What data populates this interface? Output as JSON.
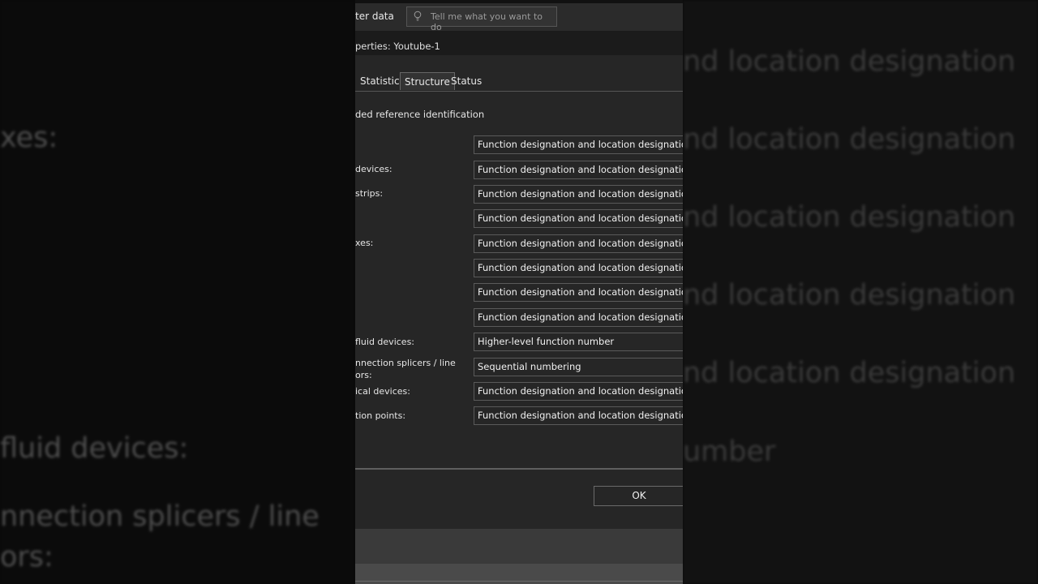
{
  "ribbon": {
    "partial_label": "ter data",
    "tellme_placeholder": "Tell me what you want to do"
  },
  "dialog": {
    "title": "perties: Youtube-1",
    "tabs": [
      "Statistics",
      "Structure",
      "Status"
    ],
    "active_tab": "Structure",
    "section_label": "ded reference identification",
    "rows": [
      {
        "label": "",
        "value": "Function designation and location designation"
      },
      {
        "label": "devices:",
        "value": "Function designation and location designation"
      },
      {
        "label": " strips:",
        "value": "Function designation and location designation"
      },
      {
        "label": "",
        "value": "Function designation and location designation"
      },
      {
        "label": "xes:",
        "value": "Function designation and location designation"
      },
      {
        "label": "",
        "value": "Function designation and location designation"
      },
      {
        "label": "",
        "value": "Function designation and location designation"
      },
      {
        "label": "",
        "value": "Function designation and location designation"
      },
      {
        "label": "fluid devices:",
        "value": "Higher-level function number"
      },
      {
        "label": "nnection splicers / line\nors:",
        "value": "Sequential numbering"
      },
      {
        "label": "ical devices:",
        "value": "Function designation and location designation"
      },
      {
        "label": "tion points:",
        "value": "Function designation and location designation"
      }
    ],
    "ok_label": "OK"
  },
  "background": {
    "right_lines": [
      "nd location designation",
      "nd location designation",
      "nd location designation",
      "nd location designation",
      "nd location designation",
      "umber"
    ],
    "left_lines": [
      "xes:",
      "fluid devices:",
      "nnection splicers / line",
      "ors:"
    ]
  },
  "colors": {
    "page_bg": "#0a0a0a",
    "dialog_bg": "#262626",
    "text": "#e6e6e6"
  }
}
